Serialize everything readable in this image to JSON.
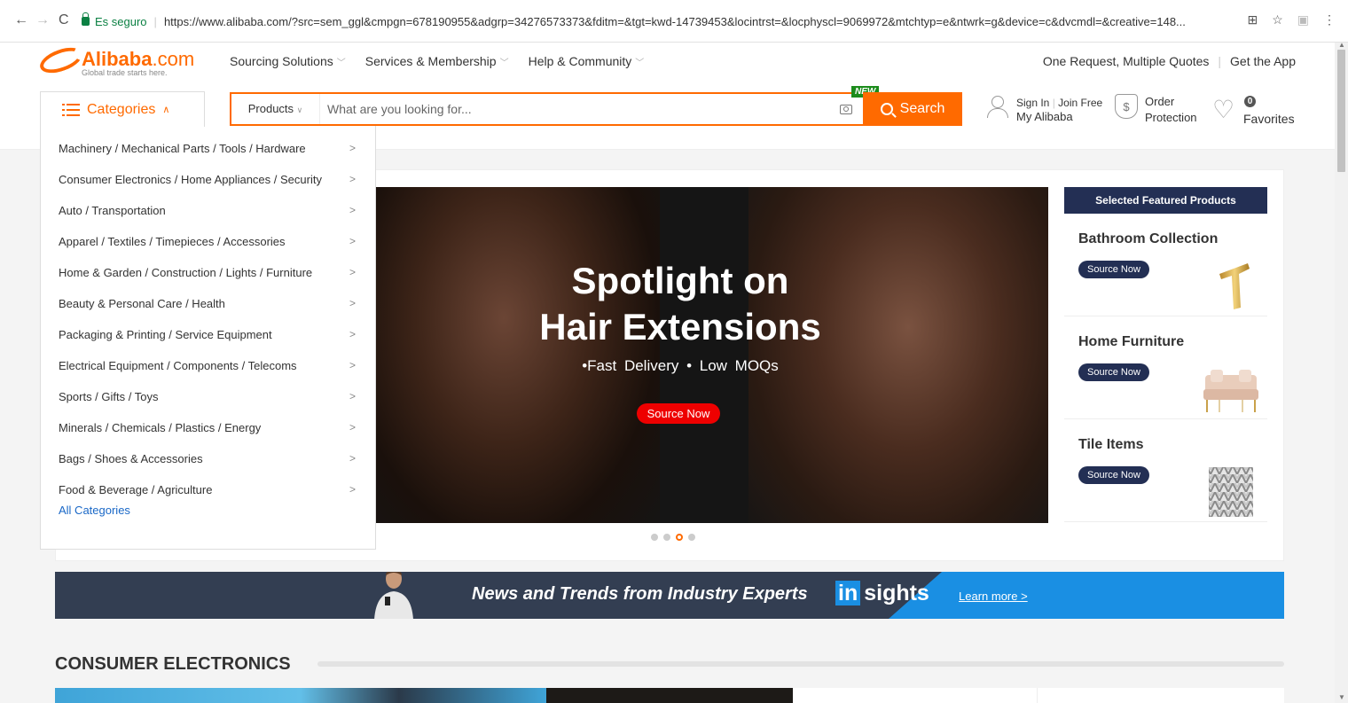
{
  "browser": {
    "secure_label": "Es seguro",
    "url": "https://www.alibaba.com/?src=sem_ggl&cmpgn=678190955&adgrp=34276573373&fditm=&tgt=kwd-14739453&locintrst=&locphyscl=9069972&mtchtyp=e&ntwrk=g&device=c&dvcmdl=&creative=148..."
  },
  "logo": {
    "name": "Alibaba",
    "suffix": ".com",
    "tagline": "Global trade starts here."
  },
  "topnav": {
    "items": [
      "Sourcing Solutions",
      "Services & Membership",
      "Help & Community"
    ],
    "right_quote": "One Request, Multiple Quotes",
    "right_app": "Get the App"
  },
  "categories_button": "Categories",
  "search": {
    "scope": "Products",
    "placeholder": "What are you looking for...",
    "button": "Search",
    "new_badge": "NEW"
  },
  "user": {
    "sign_in": "Sign In",
    "join": "Join Free",
    "my_alibaba": "My Alibaba"
  },
  "order": {
    "line1": "Order",
    "line2": "Protection"
  },
  "favorites": {
    "count": "0",
    "label": "Favorites"
  },
  "categories": [
    "Machinery / Mechanical Parts / Tools / Hardware",
    "Consumer Electronics / Home Appliances / Security",
    "Auto / Transportation",
    "Apparel / Textiles / Timepieces / Accessories",
    "Home & Garden / Construction / Lights / Furniture",
    "Beauty & Personal Care / Health",
    "Packaging & Printing / Service Equipment",
    "Electrical Equipment / Components / Telecoms",
    "Sports / Gifts / Toys",
    "Minerals / Chemicals / Plastics / Energy",
    "Bags / Shoes & Accessories",
    "Food & Beverage / Agriculture"
  ],
  "all_categories": "All Categories",
  "banner": {
    "title_line1": "Spotlight on",
    "title_line2": "Hair Extensions",
    "subtitle": "•Fast Delivery  • Low MOQs",
    "button": "Source Now",
    "active_slide": 3,
    "slide_count": 4
  },
  "featured": {
    "header": "Selected Featured Products",
    "items": [
      {
        "title": "Bathroom Collection",
        "button": "Source Now"
      },
      {
        "title": "Home Furniture",
        "button": "Source Now"
      },
      {
        "title": "Tile Items",
        "button": "Source Now"
      }
    ]
  },
  "insights": {
    "headline": "News and Trends from Industry Experts",
    "logo_in": "in",
    "logo_rest": "sights",
    "link": "Learn more >"
  },
  "section": {
    "title": "CONSUMER ELECTRONICS"
  },
  "colors": {
    "brand": "#ff6a00",
    "navy": "#232f54",
    "link": "#1a68c7",
    "insights_bg": "#333e52",
    "insights_blue": "#1a8fe3"
  }
}
